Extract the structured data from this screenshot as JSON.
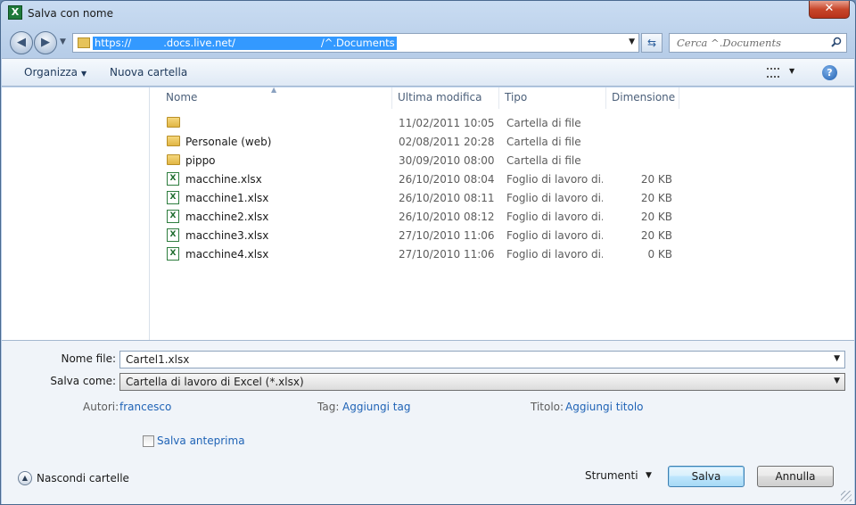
{
  "window": {
    "title": "Salva con nome",
    "app_icon_letter": "X",
    "close_glyph": "✕"
  },
  "nav": {
    "address_parts": [
      "https://",
      ".docs.live.net/",
      "/^.Documents"
    ],
    "search_placeholder": "Cerca ^.Documents"
  },
  "toolbar": {
    "organize": "Organizza",
    "new_folder": "Nuova cartella"
  },
  "table": {
    "headers": {
      "name": "Nome",
      "modified": "Ultima modifica",
      "type": "Tipo",
      "size": "Dimensione"
    },
    "rows": [
      {
        "icon": "folder-icon",
        "name": "",
        "modified": "11/02/2011 10:05",
        "type": "Cartella di file",
        "size": ""
      },
      {
        "icon": "folder-icon",
        "name": "Personale (web)",
        "modified": "02/08/2011 20:28",
        "type": "Cartella di file",
        "size": ""
      },
      {
        "icon": "folder-icon",
        "name": "pippo",
        "modified": "30/09/2010 08:00",
        "type": "Cartella di file",
        "size": ""
      },
      {
        "icon": "excel-file-icon",
        "name": "macchine.xlsx",
        "modified": "26/10/2010 08:04",
        "type": "Foglio di lavoro di...",
        "size": "20 KB"
      },
      {
        "icon": "excel-file-icon",
        "name": "macchine1.xlsx",
        "modified": "26/10/2010 08:11",
        "type": "Foglio di lavoro di...",
        "size": "20 KB"
      },
      {
        "icon": "excel-file-icon",
        "name": "macchine2.xlsx",
        "modified": "26/10/2010 08:12",
        "type": "Foglio di lavoro di...",
        "size": "20 KB"
      },
      {
        "icon": "excel-file-icon",
        "name": "macchine3.xlsx",
        "modified": "27/10/2010 11:06",
        "type": "Foglio di lavoro di...",
        "size": "20 KB"
      },
      {
        "icon": "excel-file-icon",
        "name": "macchine4.xlsx",
        "modified": "27/10/2010 11:06",
        "type": "Foglio di lavoro di...",
        "size": "0 KB"
      }
    ]
  },
  "form": {
    "filename_label": "Nome file:",
    "filename_value": "Cartel1.xlsx",
    "savetype_label": "Salva come:",
    "savetype_value": "Cartella di lavoro di Excel (*.xlsx)",
    "authors_label": "Autori:",
    "authors_value": "francesco",
    "tags_label": "Tag:",
    "tags_value": "Aggiungi tag",
    "title_label": "Titolo:",
    "title_value": "Aggiungi titolo",
    "thumbnail_label": "Salva anteprima"
  },
  "footer": {
    "hide_folders": "Nascondi cartelle",
    "tools": "Strumenti",
    "save": "Salva",
    "cancel": "Annulla"
  },
  "colors": {
    "link": "#1f63b6",
    "selection": "#3399ff",
    "title_close": "#c7462a"
  }
}
